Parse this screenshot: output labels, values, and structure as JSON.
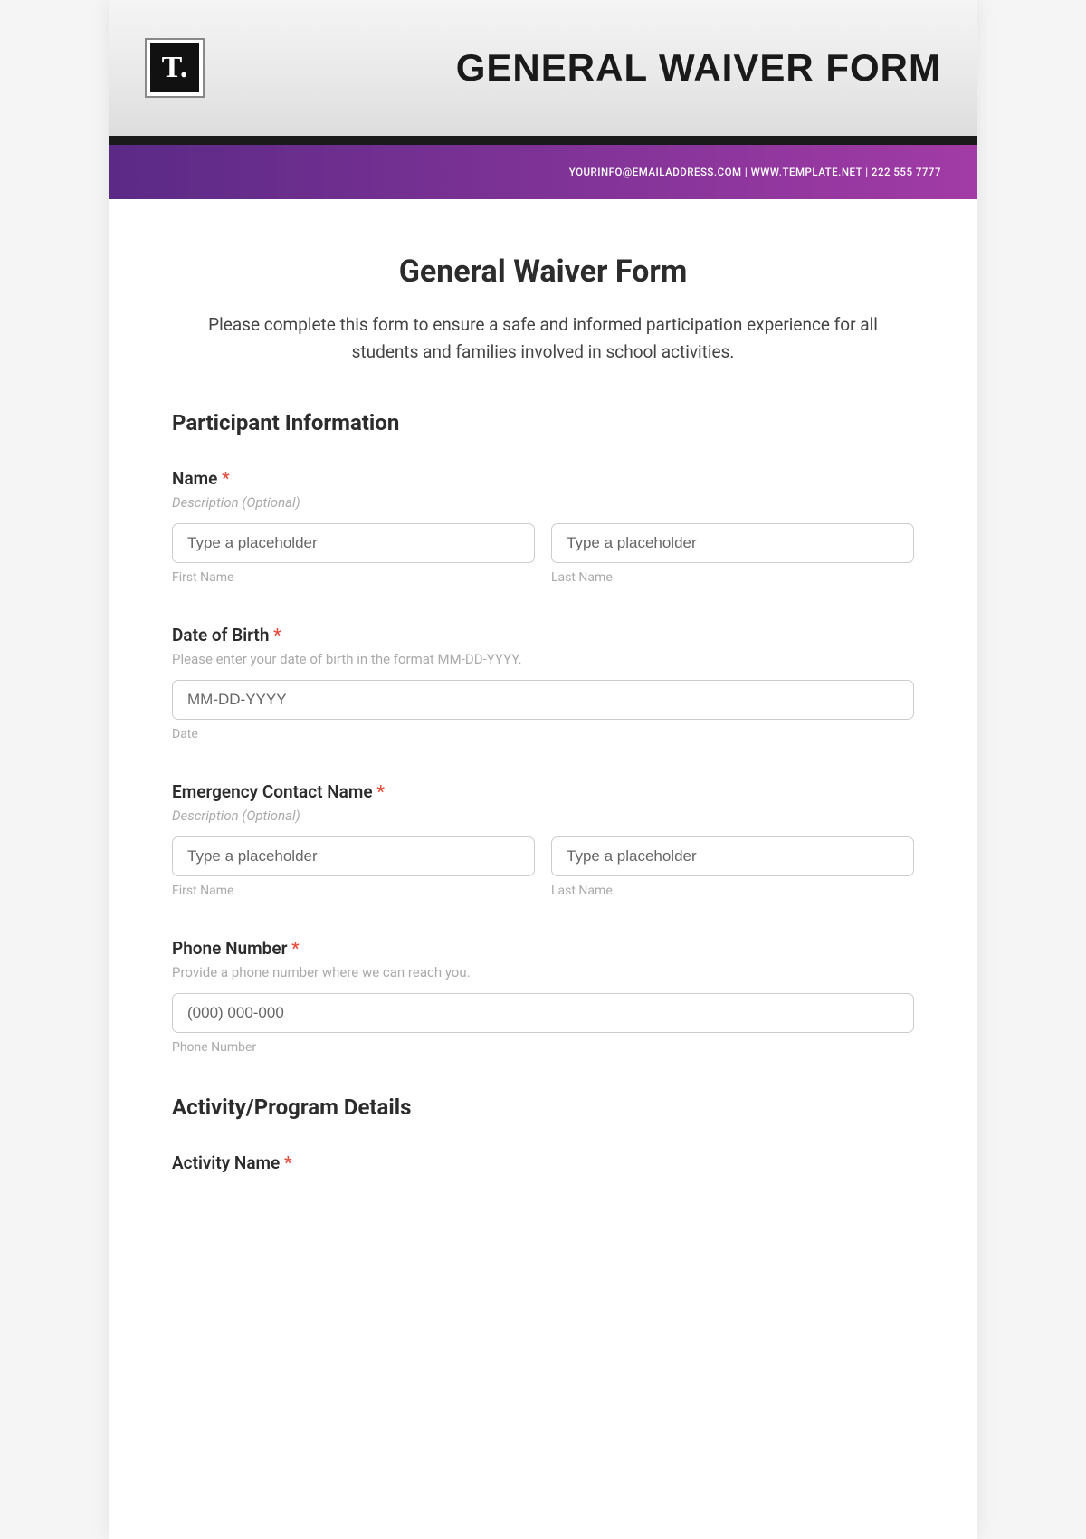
{
  "header": {
    "logo_text": "T.",
    "title": "GENERAL WAIVER FORM",
    "contact_line": "YOURINFO@EMAILADDRESS.COM | WWW.TEMPLATE.NET | 222 555 7777"
  },
  "form": {
    "title": "General Waiver Form",
    "intro": "Please complete this form to ensure a safe and informed participation experience for all students and families involved in school activities."
  },
  "sections": {
    "participant": {
      "heading": "Participant Information",
      "name": {
        "label": "Name",
        "required": "*",
        "desc": "Description (Optional)",
        "first_placeholder": "Type a placeholder",
        "last_placeholder": "Type a placeholder",
        "first_sub": "First Name",
        "last_sub": "Last Name"
      },
      "dob": {
        "label": "Date of Birth",
        "required": "*",
        "desc": "Please enter your date of birth in the format MM-DD-YYYY.",
        "placeholder": "MM-DD-YYYY",
        "sub": "Date"
      },
      "emergency": {
        "label": "Emergency Contact Name",
        "required": "*",
        "desc": "Description (Optional)",
        "first_placeholder": "Type a placeholder",
        "last_placeholder": "Type a placeholder",
        "first_sub": "First Name",
        "last_sub": "Last Name"
      },
      "phone": {
        "label": "Phone Number",
        "required": "*",
        "desc": "Provide a phone number where we can reach you.",
        "placeholder": "(000) 000-000",
        "sub": "Phone Number"
      }
    },
    "activity": {
      "heading": "Activity/Program Details",
      "activity_name": {
        "label": "Activity Name",
        "required": "*"
      }
    }
  }
}
